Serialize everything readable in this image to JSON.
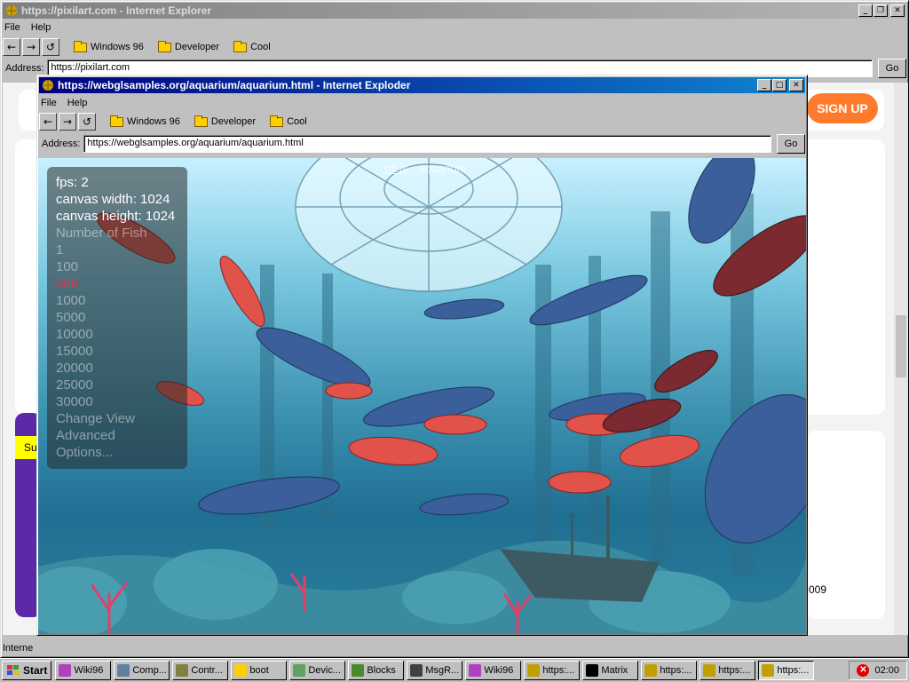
{
  "back_window": {
    "title": "https://pixilart.com - Internet Explorer",
    "menu": [
      "File",
      "Help"
    ],
    "bookmarks": [
      "Windows 96",
      "Developer",
      "Cool"
    ],
    "address_label": "Address:",
    "address_value": "https://pixilart.com",
    "go_label": "Go",
    "signup_label": "SIGN UP",
    "status_text": "Interne",
    "side_text_1": "Su",
    "side_text_2": "009"
  },
  "front_window": {
    "title": "https://webglsamples.org/aquarium/aquarium.html - Internet Exploder",
    "menu": [
      "File",
      "Help"
    ],
    "bookmarks": [
      "Windows 96",
      "Developer",
      "Cool"
    ],
    "address_label": "Address:",
    "address_value": "https://webglsamples.org/aquarium/aquarium.html",
    "go_label": "Go"
  },
  "aquarium": {
    "top_link": "tdl.js",
    "top_sep": " - ",
    "top_title": "aquarium",
    "fps": "fps: 2",
    "canvas_width": "canvas width: 1024",
    "canvas_height": "canvas height: 1024",
    "fish_header": "Number of Fish",
    "fish_options": [
      "1",
      "100",
      "500",
      "1000",
      "5000",
      "10000",
      "15000",
      "20000",
      "25000",
      "30000"
    ],
    "selected_fish": "500",
    "menu_items": [
      "Change View",
      "Advanced",
      "Options..."
    ]
  },
  "taskbar": {
    "start_label": "Start",
    "items": [
      {
        "label": "Wiki96",
        "color": "#b040c0"
      },
      {
        "label": "Comp...",
        "color": "#6080a0"
      },
      {
        "label": "Contr...",
        "color": "#808040"
      },
      {
        "label": "boot",
        "color": "#ffd000"
      },
      {
        "label": "Devic...",
        "color": "#60a060"
      },
      {
        "label": "Blocks",
        "color": "#4a8a2a"
      },
      {
        "label": "MsgR...",
        "color": "#404040"
      },
      {
        "label": "Wiki96",
        "color": "#b040c0"
      },
      {
        "label": "https:...",
        "color": "#c0a000"
      },
      {
        "label": "Matrix",
        "color": "#000000"
      },
      {
        "label": "https:...",
        "color": "#c0a000"
      },
      {
        "label": "https:...",
        "color": "#c0a000"
      },
      {
        "label": "https:...",
        "color": "#c0a000"
      }
    ],
    "clock": "02:00"
  }
}
